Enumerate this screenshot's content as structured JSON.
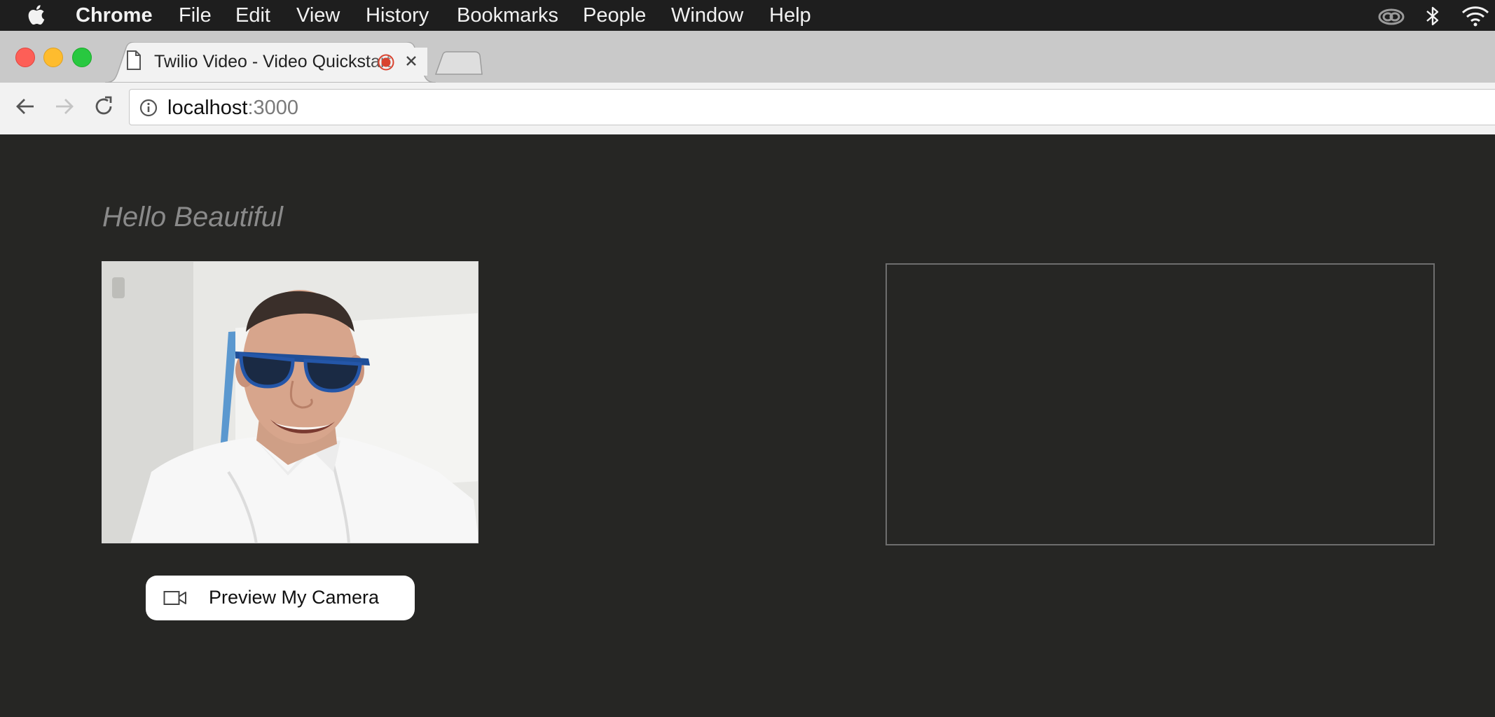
{
  "menubar": {
    "app_name": "Chrome",
    "items": [
      {
        "label": "File"
      },
      {
        "label": "Edit"
      },
      {
        "label": "View"
      },
      {
        "label": "History"
      },
      {
        "label": "Bookmarks"
      },
      {
        "label": "People"
      },
      {
        "label": "Window"
      },
      {
        "label": "Help"
      }
    ],
    "status_icons": [
      "creative-cloud-icon",
      "bluetooth-icon",
      "wifi-icon"
    ]
  },
  "browser": {
    "tab": {
      "title": "Twilio Video - Video Quickstart",
      "icon": "document-icon",
      "recording_indicator": "recording-dot-icon",
      "recording_color": "#d9432f"
    },
    "address_bar": {
      "host": "localhost",
      "port": ":3000"
    }
  },
  "page": {
    "greeting": "Hello Beautiful",
    "preview_button": {
      "label": "Preview My Camera",
      "icon": "video-camera-icon"
    },
    "background_color": "#262624"
  }
}
